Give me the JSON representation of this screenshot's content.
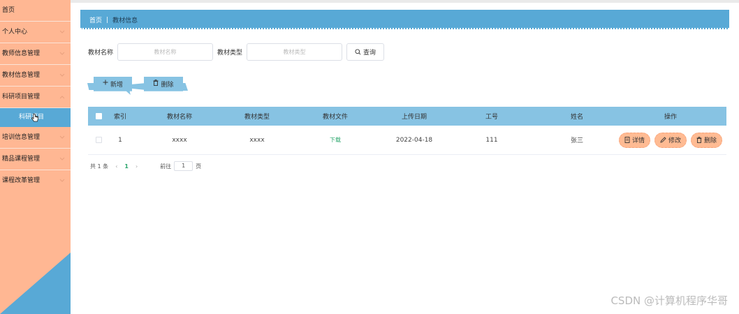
{
  "sidebar": {
    "items": [
      {
        "label": "首页",
        "chevron": false
      },
      {
        "label": "个人中心",
        "chevron": true
      },
      {
        "label": "教师信息管理",
        "chevron": true
      },
      {
        "label": "教材信息管理",
        "chevron": true
      },
      {
        "label": "科研项目管理",
        "chevron": true
      }
    ],
    "sub_item": "科研项目",
    "items_after": [
      {
        "label": "培训信息管理",
        "chevron": true
      },
      {
        "label": "精品课程管理",
        "chevron": true
      },
      {
        "label": "课程改革管理",
        "chevron": true
      }
    ],
    "accent_color": "#58a9d6",
    "background_color": "#ffb793"
  },
  "breadcrumb": {
    "home": "首页",
    "separator": "|",
    "current": "教材信息"
  },
  "search": {
    "name_label": "教材名称",
    "name_placeholder": "教材名称",
    "type_label": "教材类型",
    "type_placeholder": "教材类型",
    "button_label": "查询",
    "button_icon": "search-icon"
  },
  "actions": {
    "add_label": "新增",
    "add_icon": "plus-icon",
    "delete_label": "删除",
    "delete_icon": "trash-icon"
  },
  "table": {
    "headers": [
      "索引",
      "教材名称",
      "教材类型",
      "教材文件",
      "上传日期",
      "工号",
      "姓名",
      "操作"
    ],
    "rows": [
      {
        "index": "1",
        "name": "xxxx",
        "type": "xxxx",
        "file": "下载",
        "date": "2022-04-18",
        "job_no": "111",
        "person": "张三",
        "ops": {
          "detail": "详情",
          "edit": "修改",
          "delete": "删除"
        }
      }
    ]
  },
  "pagination": {
    "total": "共 1 条",
    "current_page": "1",
    "goto_label": "前往",
    "goto_value": "1",
    "page_suffix": "页"
  },
  "watermark": "CSDN @计算机程序华哥"
}
